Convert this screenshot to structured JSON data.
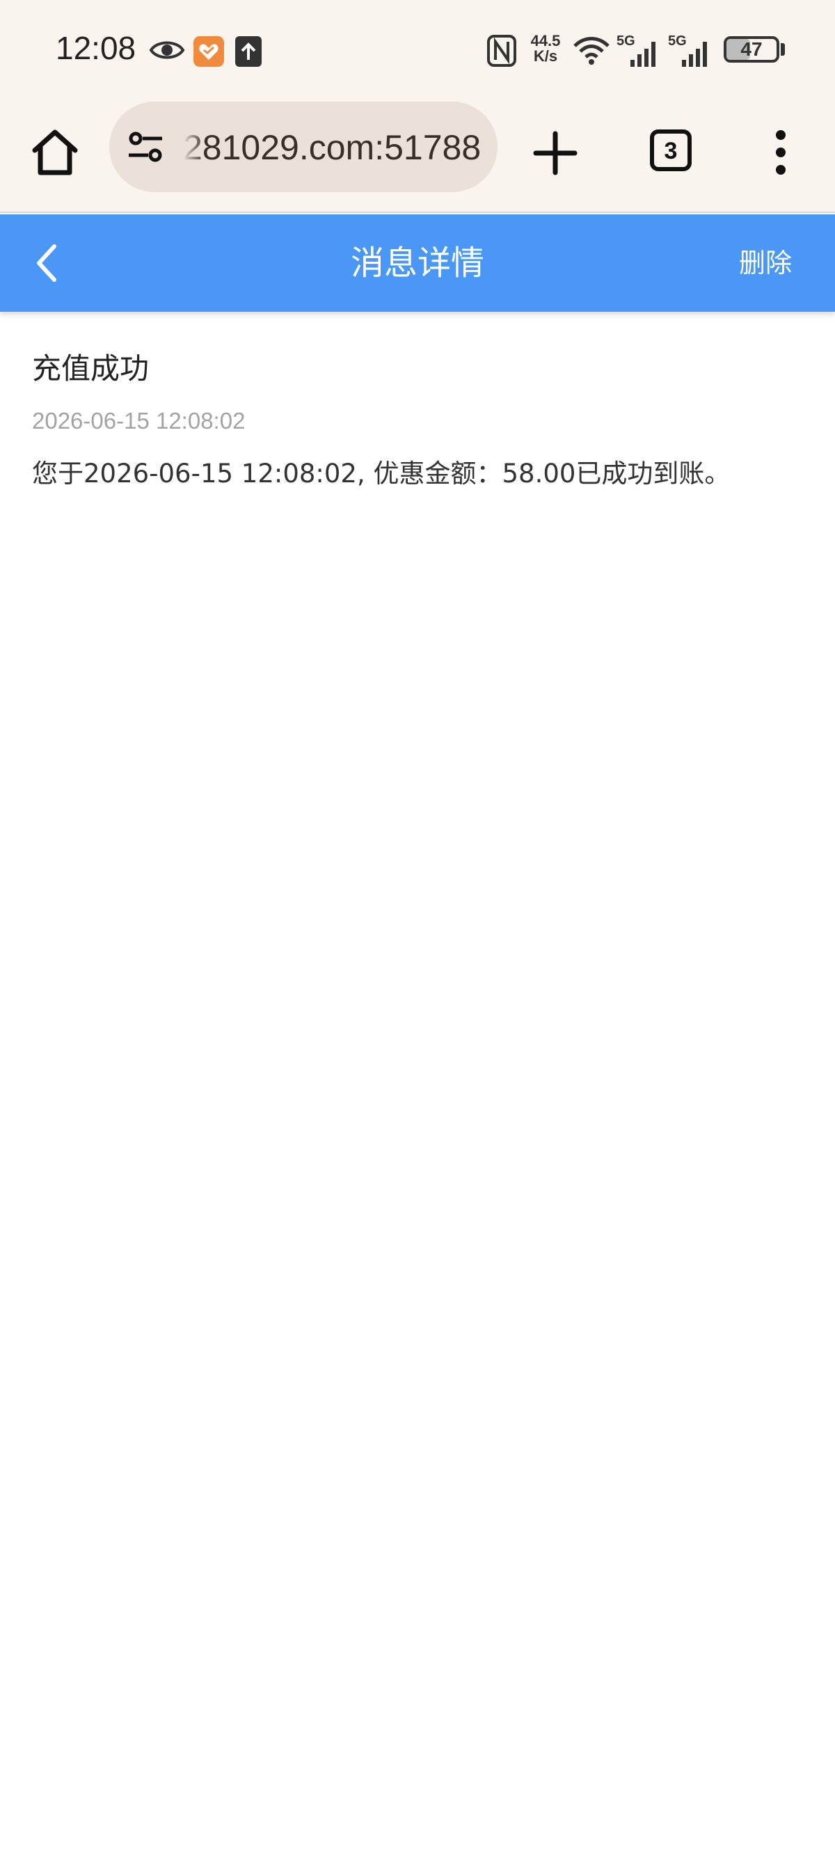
{
  "status_bar": {
    "time": "12:08",
    "net_speed_value": "44.5",
    "net_speed_unit": "K/s",
    "signal1_label": "5G",
    "signal2_label": "5G",
    "battery_level": "47",
    "icons": [
      "eye-icon",
      "health-app-icon",
      "upload-icon",
      "nfc-icon",
      "wifi-icon",
      "cell-signal-icon",
      "battery-icon"
    ]
  },
  "browser": {
    "url": "281029.com:51788",
    "tab_count": "3",
    "icons": [
      "home-icon",
      "site-settings-icon",
      "plus-icon",
      "tabs-icon",
      "more-vert-icon"
    ]
  },
  "app_bar": {
    "title": "消息详情",
    "delete_label": "删除",
    "color": "#4a97f5"
  },
  "message": {
    "title": "充值成功",
    "time": "2026-06-15 12:08:02",
    "body": "您于2026-06-15 12:08:02, 优惠金额：58.00已成功到账。"
  }
}
